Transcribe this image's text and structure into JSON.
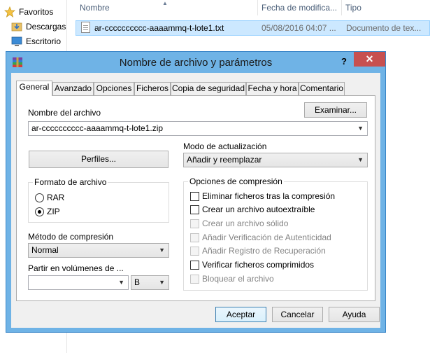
{
  "explorer": {
    "nav_items": [
      {
        "label": "Favoritos",
        "icon": "star-icon"
      },
      {
        "label": "Descargas",
        "icon": "downloads-folder-icon"
      },
      {
        "label": "Escritorio",
        "icon": "desktop-icon"
      }
    ],
    "columns": {
      "name": "Nombre",
      "date": "Fecha de modifica...",
      "type": "Tipo"
    },
    "file": {
      "name": "ar-cccccccccc-aaaammq-t-lote1.txt",
      "date": "05/08/2016 04:07 ...",
      "type": "Documento de tex..."
    }
  },
  "dialog": {
    "title": "Nombre de archivo y parámetros",
    "help": "?",
    "close": "✕",
    "tabs": [
      "General",
      "Avanzado",
      "Opciones",
      "Ficheros",
      "Copia de seguridad",
      "Fecha y hora",
      "Comentario"
    ],
    "active_tab": "General",
    "archive_name_label": "Nombre del archivo",
    "browse_button": "Examinar...",
    "archive_name_value": "ar-cccccccccc-aaaammq-t-lote1.zip",
    "profiles_button": "Perfiles...",
    "update_mode_label": "Modo de actualización",
    "update_mode_value": "Añadir y reemplazar",
    "format_group": "Formato de archivo",
    "format_options": [
      {
        "label": "RAR",
        "selected": false
      },
      {
        "label": "ZIP",
        "selected": true
      }
    ],
    "compression_method_label": "Método de compresión",
    "compression_method_value": "Normal",
    "split_label": "Partir en volúmenes de ...",
    "split_value": "",
    "split_unit": "B",
    "options_group": "Opciones de compresión",
    "options": [
      {
        "label": "Eliminar ficheros tras la compresión",
        "checked": false,
        "enabled": true
      },
      {
        "label": "Crear un archivo autoextraíble",
        "checked": false,
        "enabled": true
      },
      {
        "label": "Crear un archivo sólido",
        "checked": false,
        "enabled": false
      },
      {
        "label": "Añadir Verificación de Autenticidad",
        "checked": false,
        "enabled": false
      },
      {
        "label": "Añadir Registro de Recuperación",
        "checked": false,
        "enabled": false
      },
      {
        "label": "Verificar ficheros comprimidos",
        "checked": false,
        "enabled": true
      },
      {
        "label": "Bloquear el archivo",
        "checked": false,
        "enabled": false
      }
    ],
    "buttons": {
      "accept": "Aceptar",
      "cancel": "Cancelar",
      "help": "Ayuda"
    }
  }
}
